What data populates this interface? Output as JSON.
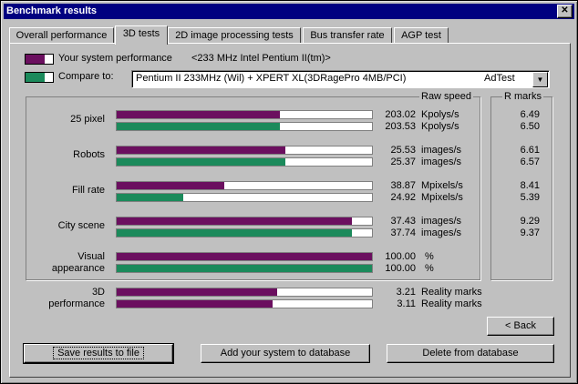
{
  "window": {
    "title": "Benchmark results",
    "close": "✕"
  },
  "tabs": [
    {
      "label": "Overall performance"
    },
    {
      "label": "3D tests"
    },
    {
      "label": "2D image processing tests"
    },
    {
      "label": "Bus transfer rate"
    },
    {
      "label": "AGP test"
    }
  ],
  "colors": {
    "system": "#6b0f5f",
    "compare": "#1b8a5b"
  },
  "system_label": "Your system performance",
  "system_value": "<233 MHz Intel Pentium II(tm)>",
  "compare_label": "Compare to:",
  "compare_select": {
    "value": "Pentium II 233MHz (Wil) + XPERT XL(3DRagePro 4MB/PCI)",
    "value2": "AdTest"
  },
  "raw_speed_title": "Raw speed",
  "r_marks_title": "R marks",
  "rows": [
    {
      "name": "25 pixel",
      "sys": {
        "pct": 0.64,
        "value": "203.02",
        "unit": "Kpolys/s",
        "mark": "6.49"
      },
      "cmp": {
        "pct": 0.64,
        "value": "203.53",
        "unit": "Kpolys/s",
        "mark": "6.50"
      }
    },
    {
      "name": "Robots",
      "sys": {
        "pct": 0.66,
        "value": "25.53",
        "unit": "images/s",
        "mark": "6.61"
      },
      "cmp": {
        "pct": 0.66,
        "value": "25.37",
        "unit": "images/s",
        "mark": "6.57"
      }
    },
    {
      "name": "Fill rate",
      "sys": {
        "pct": 0.42,
        "value": "38.87",
        "unit": "Mpixels/s",
        "mark": "8.41"
      },
      "cmp": {
        "pct": 0.26,
        "value": "24.92",
        "unit": "Mpixels/s",
        "mark": "5.39"
      }
    },
    {
      "name": "City scene",
      "sys": {
        "pct": 0.92,
        "value": "37.43",
        "unit": "images/s",
        "mark": "9.29"
      },
      "cmp": {
        "pct": 0.92,
        "value": "37.74",
        "unit": "images/s",
        "mark": "9.37"
      }
    },
    {
      "name1": "Visual",
      "name2": "appearance",
      "sys": {
        "pct": 1.0,
        "value": "100.00",
        "unit": "%",
        "mark": ""
      },
      "cmp": {
        "pct": 1.0,
        "value": "100.00",
        "unit": "%",
        "mark": ""
      }
    }
  ],
  "perf": {
    "name1": "3D",
    "name2": "performance",
    "sys": {
      "pct": 0.63,
      "value": "3.21",
      "unit": "Reality marks"
    },
    "cmp": {
      "pct": 0.61,
      "value": "3.11",
      "unit": "Reality marks"
    }
  },
  "buttons": {
    "back": "< Back",
    "save": "Save results to file",
    "add": "Add your system to database",
    "delete": "Delete from database"
  }
}
